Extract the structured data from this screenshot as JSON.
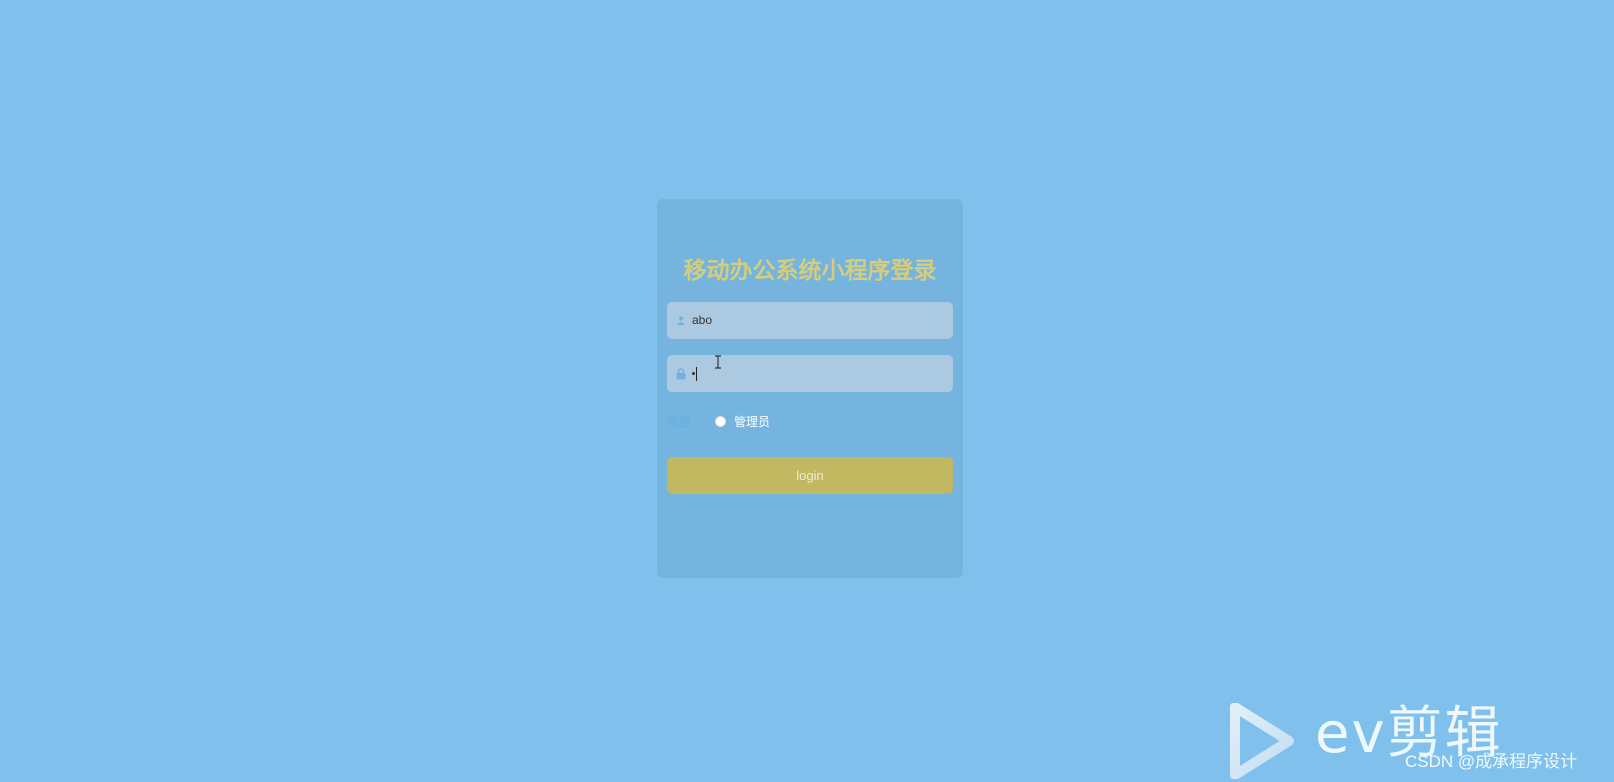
{
  "page": {
    "background_color": "#7fc1ec",
    "card_color": "#74b4df",
    "accent_color": "#d6cd7c",
    "button_color": "#c2b862"
  },
  "login": {
    "title": "移动办公系统小程序登录",
    "username": {
      "icon": "user-icon",
      "value": "abo"
    },
    "password": {
      "icon": "lock-icon",
      "masked_value": "•"
    },
    "role": {
      "label": "角色",
      "options": [
        "管理员"
      ],
      "selected": null
    },
    "submit_label": "login"
  },
  "watermark": {
    "brand": "ev剪辑",
    "logo_icon": "play-triangle-icon",
    "credit": "CSDN @成承程序设计"
  }
}
